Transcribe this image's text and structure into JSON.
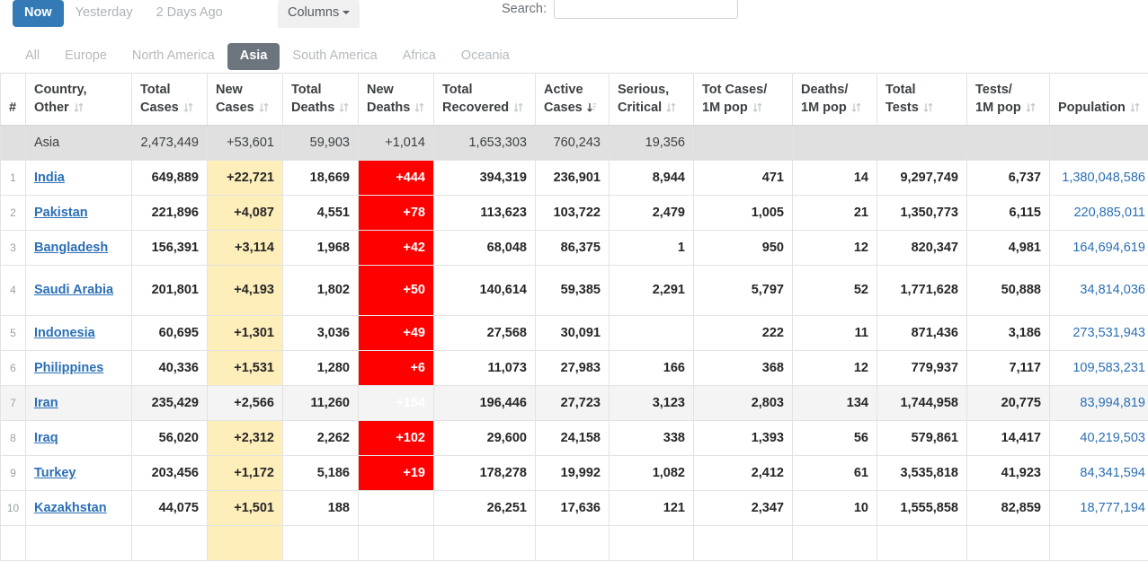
{
  "toolbar": {
    "time_tabs": [
      {
        "label": "Now",
        "active": true
      },
      {
        "label": "Yesterday",
        "active": false
      },
      {
        "label": "2 Days Ago",
        "active": false
      }
    ],
    "columns_label": "Columns",
    "search_label": "Search:",
    "search_value": "",
    "search_placeholder": ""
  },
  "continent_tabs": [
    {
      "label": "All",
      "active": false
    },
    {
      "label": "Europe",
      "active": false
    },
    {
      "label": "North America",
      "active": false
    },
    {
      "label": "Asia",
      "active": true
    },
    {
      "label": "South America",
      "active": false
    },
    {
      "label": "Africa",
      "active": false
    },
    {
      "label": "Oceania",
      "active": false
    }
  ],
  "colors": {
    "now_tab_blue": "#337ab7",
    "continent_tab_gray": "#6c757d",
    "new_cases_yellow": "#fdeeba",
    "new_deaths_red": "#ff0000",
    "link_blue": "#2b6fb5",
    "total_row_gray": "#e0e0e0"
  },
  "table": {
    "headers": [
      {
        "line1": "#",
        "line2": "",
        "sort": "none"
      },
      {
        "line1": "Country,",
        "line2": "Other",
        "sort": "both"
      },
      {
        "line1": "Total",
        "line2": "Cases",
        "sort": "both"
      },
      {
        "line1": "New",
        "line2": "Cases",
        "sort": "both"
      },
      {
        "line1": "Total",
        "line2": "Deaths",
        "sort": "both"
      },
      {
        "line1": "New",
        "line2": "Deaths",
        "sort": "both"
      },
      {
        "line1": "Total",
        "line2": "Recovered",
        "sort": "both"
      },
      {
        "line1": "Active",
        "line2": "Cases",
        "sort": "desc"
      },
      {
        "line1": "Serious,",
        "line2": "Critical",
        "sort": "both"
      },
      {
        "line1": "Tot Cases/",
        "line2": "1M pop",
        "sort": "both"
      },
      {
        "line1": "Deaths/",
        "line2": "1M pop",
        "sort": "both"
      },
      {
        "line1": "Total",
        "line2": "Tests",
        "sort": "both"
      },
      {
        "line1": "Tests/",
        "line2": "1M pop",
        "sort": "both"
      },
      {
        "line1": "Population",
        "line2": "",
        "sort": "both"
      }
    ],
    "total_row": {
      "index": "",
      "country": "Asia",
      "total_cases": "2,473,449",
      "new_cases": "+53,601",
      "total_deaths": "59,903",
      "new_deaths": "+1,014",
      "total_recovered": "1,653,303",
      "active_cases": "760,243",
      "serious_critical": "19,356",
      "tot_cases_1m": "",
      "deaths_1m": "",
      "total_tests": "",
      "tests_1m": "",
      "population": ""
    },
    "rows": [
      {
        "index": "1",
        "country": "India",
        "total_cases": "649,889",
        "new_cases": "+22,721",
        "total_deaths": "18,669",
        "new_deaths": "+444",
        "total_recovered": "394,319",
        "active_cases": "236,901",
        "serious_critical": "8,944",
        "tot_cases_1m": "471",
        "deaths_1m": "14",
        "total_tests": "9,297,749",
        "tests_1m": "6,737",
        "population": "1,380,048,586",
        "tall": false,
        "hover": false
      },
      {
        "index": "2",
        "country": "Pakistan",
        "total_cases": "221,896",
        "new_cases": "+4,087",
        "total_deaths": "4,551",
        "new_deaths": "+78",
        "total_recovered": "113,623",
        "active_cases": "103,722",
        "serious_critical": "2,479",
        "tot_cases_1m": "1,005",
        "deaths_1m": "21",
        "total_tests": "1,350,773",
        "tests_1m": "6,115",
        "population": "220,885,011",
        "tall": false,
        "hover": false
      },
      {
        "index": "3",
        "country": "Bangladesh",
        "total_cases": "156,391",
        "new_cases": "+3,114",
        "total_deaths": "1,968",
        "new_deaths": "+42",
        "total_recovered": "68,048",
        "active_cases": "86,375",
        "serious_critical": "1",
        "tot_cases_1m": "950",
        "deaths_1m": "12",
        "total_tests": "820,347",
        "tests_1m": "4,981",
        "population": "164,694,619",
        "tall": false,
        "hover": false
      },
      {
        "index": "4",
        "country": "Saudi Arabia",
        "total_cases": "201,801",
        "new_cases": "+4,193",
        "total_deaths": "1,802",
        "new_deaths": "+50",
        "total_recovered": "140,614",
        "active_cases": "59,385",
        "serious_critical": "2,291",
        "tot_cases_1m": "5,797",
        "deaths_1m": "52",
        "total_tests": "1,771,628",
        "tests_1m": "50,888",
        "population": "34,814,036",
        "tall": true,
        "hover": false
      },
      {
        "index": "5",
        "country": "Indonesia",
        "total_cases": "60,695",
        "new_cases": "+1,301",
        "total_deaths": "3,036",
        "new_deaths": "+49",
        "total_recovered": "27,568",
        "active_cases": "30,091",
        "serious_critical": "",
        "tot_cases_1m": "222",
        "deaths_1m": "11",
        "total_tests": "871,436",
        "tests_1m": "3,186",
        "population": "273,531,943",
        "tall": false,
        "hover": false
      },
      {
        "index": "6",
        "country": "Philippines",
        "total_cases": "40,336",
        "new_cases": "+1,531",
        "total_deaths": "1,280",
        "new_deaths": "+6",
        "total_recovered": "11,073",
        "active_cases": "27,983",
        "serious_critical": "166",
        "tot_cases_1m": "368",
        "deaths_1m": "12",
        "total_tests": "779,937",
        "tests_1m": "7,117",
        "population": "109,583,231",
        "tall": false,
        "hover": false
      },
      {
        "index": "7",
        "country": "Iran",
        "total_cases": "235,429",
        "new_cases": "+2,566",
        "total_deaths": "11,260",
        "new_deaths": "+154",
        "total_recovered": "196,446",
        "active_cases": "27,723",
        "serious_critical": "3,123",
        "tot_cases_1m": "2,803",
        "deaths_1m": "134",
        "total_tests": "1,744,958",
        "tests_1m": "20,775",
        "population": "83,994,819",
        "tall": false,
        "hover": true
      },
      {
        "index": "8",
        "country": "Iraq",
        "total_cases": "56,020",
        "new_cases": "+2,312",
        "total_deaths": "2,262",
        "new_deaths": "+102",
        "total_recovered": "29,600",
        "active_cases": "24,158",
        "serious_critical": "338",
        "tot_cases_1m": "1,393",
        "deaths_1m": "56",
        "total_tests": "579,861",
        "tests_1m": "14,417",
        "population": "40,219,503",
        "tall": false,
        "hover": false
      },
      {
        "index": "9",
        "country": "Turkey",
        "total_cases": "203,456",
        "new_cases": "+1,172",
        "total_deaths": "5,186",
        "new_deaths": "+19",
        "total_recovered": "178,278",
        "active_cases": "19,992",
        "serious_critical": "1,082",
        "tot_cases_1m": "2,412",
        "deaths_1m": "61",
        "total_tests": "3,535,818",
        "tests_1m": "41,923",
        "population": "84,341,594",
        "tall": false,
        "hover": false
      },
      {
        "index": "10",
        "country": "Kazakhstan",
        "total_cases": "44,075",
        "new_cases": "+1,501",
        "total_deaths": "188",
        "new_deaths": "",
        "total_recovered": "26,251",
        "active_cases": "17,636",
        "serious_critical": "121",
        "tot_cases_1m": "2,347",
        "deaths_1m": "10",
        "total_tests": "1,555,858",
        "tests_1m": "82,859",
        "population": "18,777,194",
        "tall": false,
        "hover": false
      },
      {
        "index": "",
        "country": "",
        "total_cases": "",
        "new_cases": "",
        "total_deaths": "",
        "new_deaths": "",
        "total_recovered": "",
        "active_cases": "",
        "serious_critical": "",
        "tot_cases_1m": "",
        "deaths_1m": "",
        "total_tests": "",
        "tests_1m": "",
        "population": "",
        "tall": false,
        "hover": false
      }
    ]
  }
}
